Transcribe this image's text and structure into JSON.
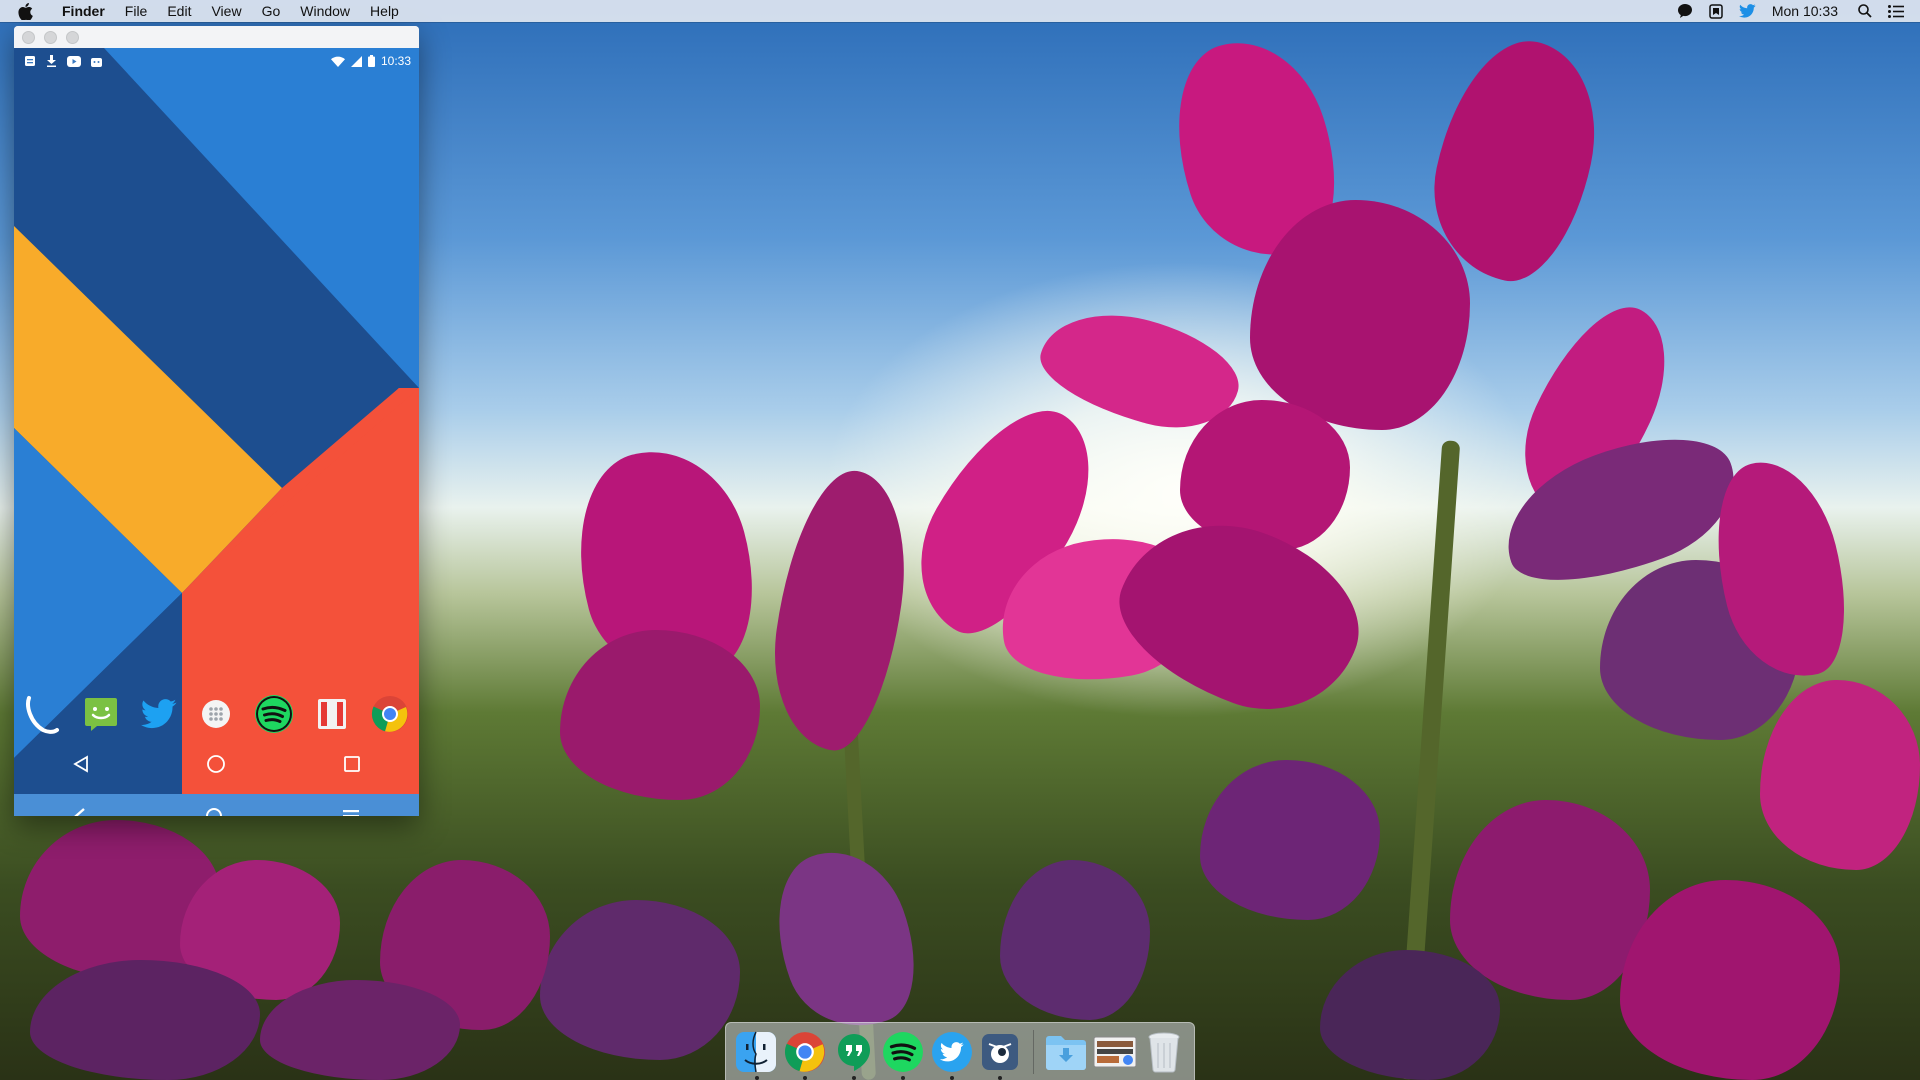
{
  "menubar": {
    "app_name": "Finder",
    "items": [
      "File",
      "Edit",
      "View",
      "Go",
      "Window",
      "Help"
    ],
    "clock": "Mon 10:33"
  },
  "emulator": {
    "status_time": "10:33",
    "wallpaper_colors": {
      "blue": "#2a7fd4",
      "dark_blue": "#1d4e8f",
      "yellow": "#f8ab2a",
      "red": "#f4513a"
    },
    "dock_apps": [
      "phone-icon",
      "messenger-icon",
      "twitter-icon",
      "app-drawer-icon",
      "spotify-icon",
      "app-icon",
      "chrome-icon"
    ]
  },
  "mac_dock": {
    "apps": [
      "finder-icon",
      "chrome-icon",
      "hangouts-icon",
      "spotify-icon",
      "twitter-icon",
      "emulator-icon"
    ],
    "right_items": [
      "downloads-folder-icon",
      "screenshot-icon",
      "trash-icon"
    ]
  }
}
